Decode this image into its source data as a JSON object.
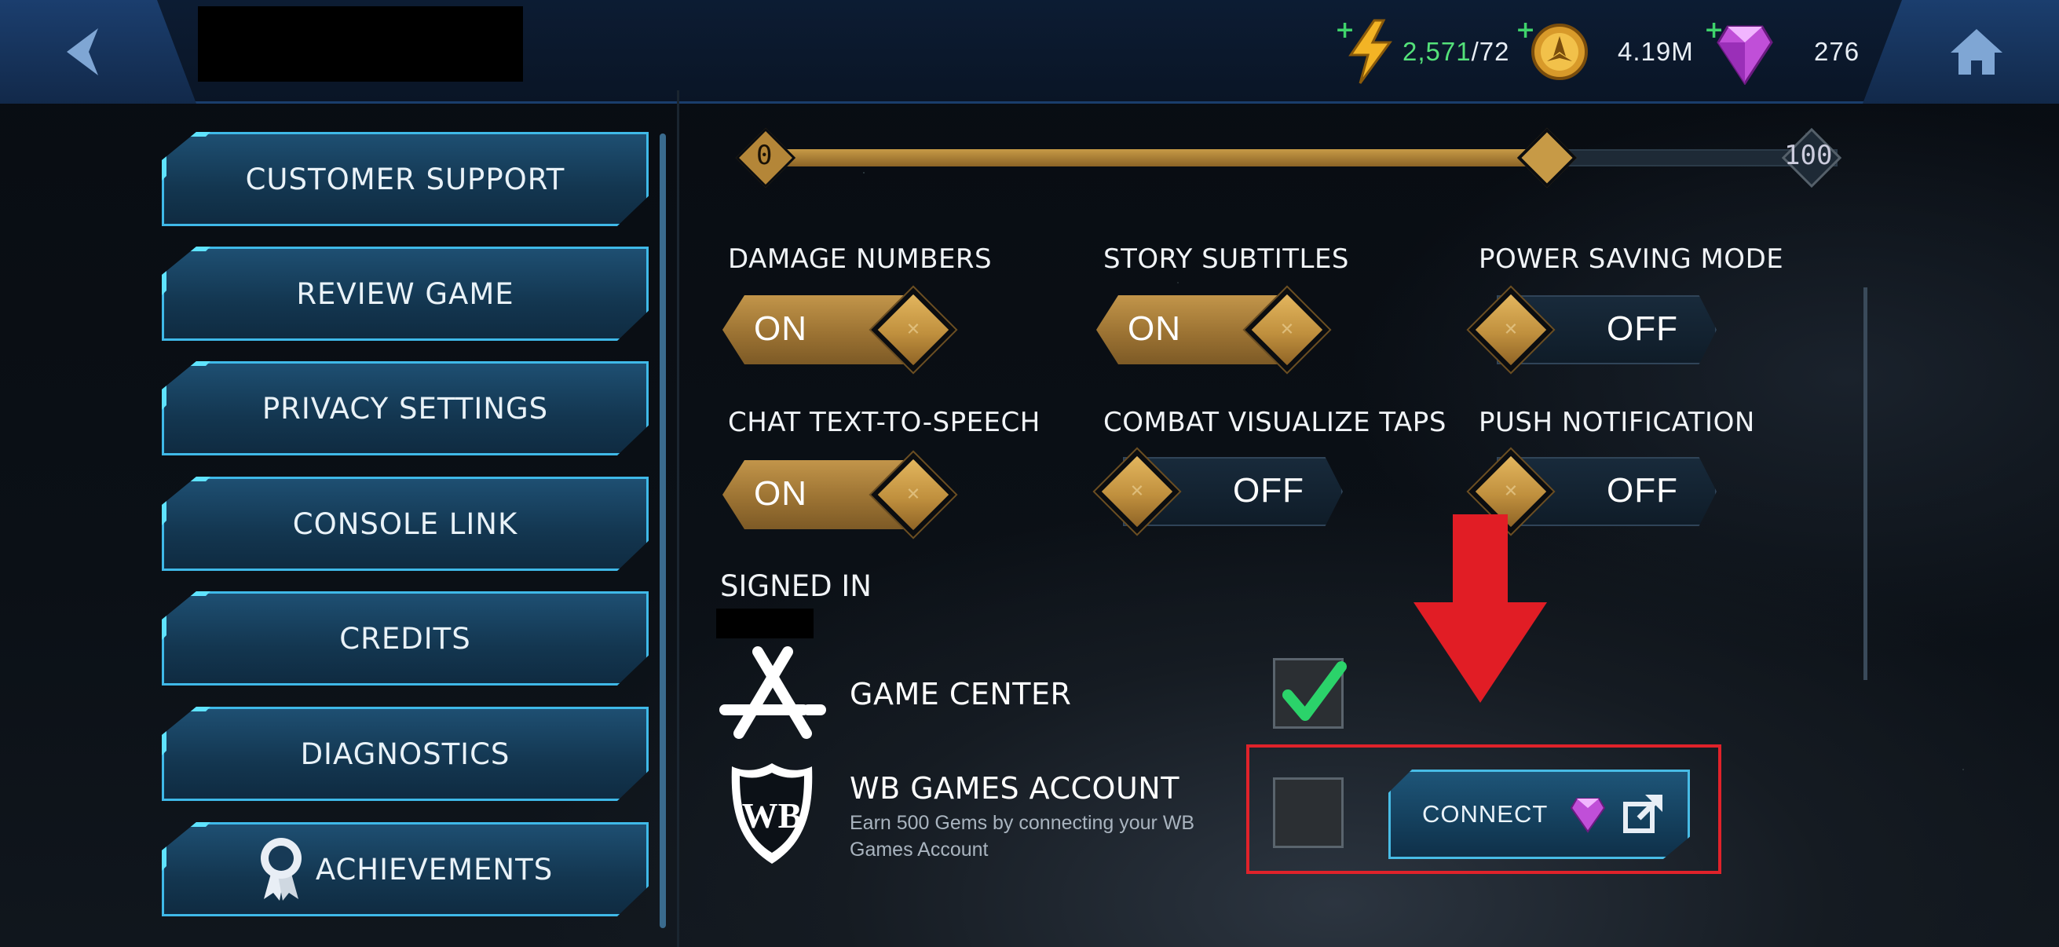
{
  "topbar": {
    "energy_current": "2,571",
    "energy_max": "/72",
    "coins": "4.19M",
    "gems": "276"
  },
  "menu": {
    "items": [
      {
        "label": "CUSTOMER SUPPORT"
      },
      {
        "label": "REVIEW GAME"
      },
      {
        "label": "PRIVACY SETTINGS"
      },
      {
        "label": "CONSOLE LINK"
      },
      {
        "label": "CREDITS"
      },
      {
        "label": "DIAGNOSTICS"
      },
      {
        "label": "ACHIEVEMENTS"
      }
    ]
  },
  "slider": {
    "min_label": "0",
    "max_label": "100",
    "value_fraction": 0.73
  },
  "settings": [
    {
      "label": "DAMAGE NUMBERS",
      "state": "ON"
    },
    {
      "label": "STORY SUBTITLES",
      "state": "ON"
    },
    {
      "label": "POWER SAVING MODE",
      "state": "OFF"
    },
    {
      "label": "CHAT TEXT-TO-SPEECH",
      "state": "ON"
    },
    {
      "label": "COMBAT VISUALIZE TAPS",
      "state": "OFF"
    },
    {
      "label": "PUSH NOTIFICATION",
      "state": "OFF"
    }
  ],
  "signed_in": {
    "title": "SIGNED IN",
    "accounts": [
      {
        "name": "GAME CENTER",
        "checked": true
      },
      {
        "name": "WB GAMES ACCOUNT",
        "subtitle": "Earn 500 Gems by connecting your WB Games Account",
        "checked": false
      }
    ],
    "connect_label": "CONNECT"
  },
  "colors": {
    "accent_blue": "#3fb9e8",
    "toggle_gold": "#c2954a",
    "highlight_red": "#e0222a",
    "check_green": "#2bd36a"
  }
}
